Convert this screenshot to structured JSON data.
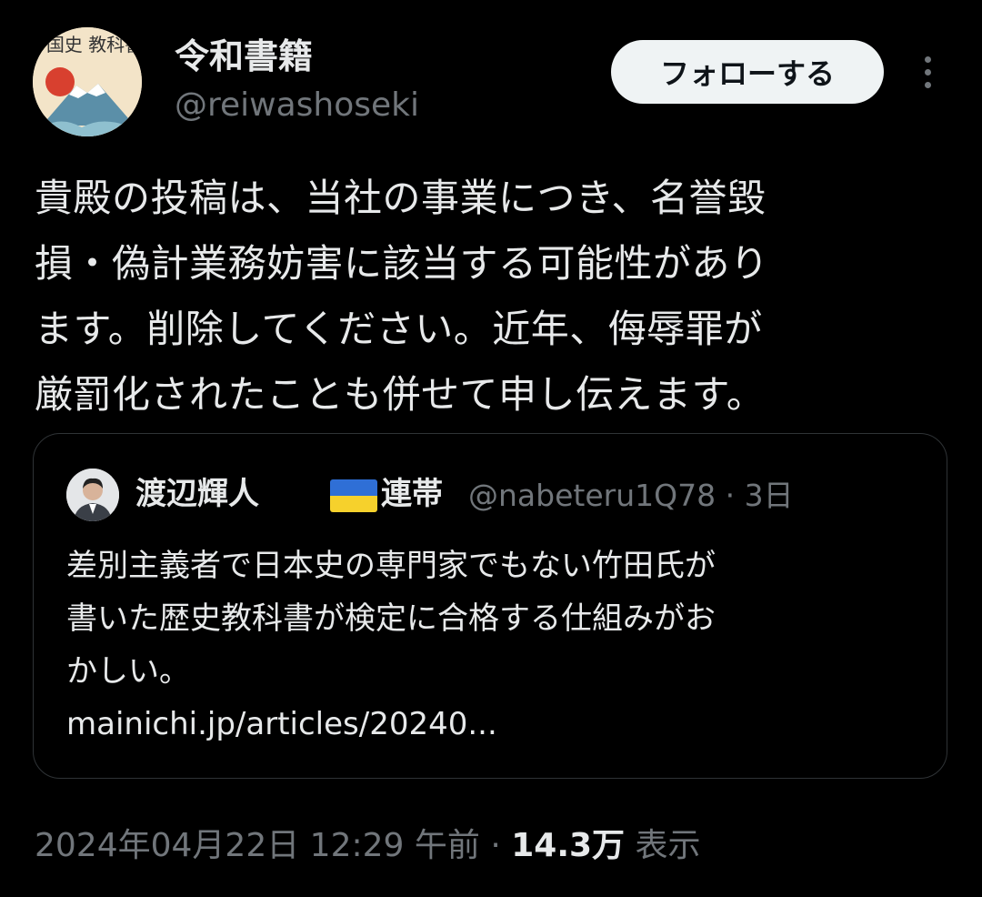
{
  "author": {
    "display_name": "令和書籍",
    "handle": "@reiwashoseki",
    "avatar_text": "国史 教科書"
  },
  "follow_label": "フォローする",
  "tweet_text_lines": [
    "貴殿の投稿は、当社の事業につき、名誉毀",
    "損・偽計業務妨害に該当する可能性があり",
    "ます。削除してください。近年、侮辱罪が",
    "厳罰化されたことも併せて申し伝えます。"
  ],
  "quote": {
    "name": "渡辺輝人",
    "flag": "ukraine-flag",
    "name_suffix": "連帯",
    "handle": "@nabeteru1Q78",
    "separator": "·",
    "time": "3日",
    "text_lines": [
      "差別主義者で日本史の専門家でもない竹田氏が",
      "書いた歴史教科書が検定に合格する仕組みがお",
      "かしい。",
      "mainichi.jp/articles/20240..."
    ]
  },
  "footer": {
    "timestamp": "2024年04月22日 12:29 午前",
    "separator": "·",
    "views_count": "14.3万",
    "views_label": "表示"
  },
  "colors": {
    "background": "#000000",
    "text_primary": "#e7e9ea",
    "text_secondary": "#71767b",
    "border": "#2f3336",
    "follow_button_bg": "#eff3f4"
  }
}
